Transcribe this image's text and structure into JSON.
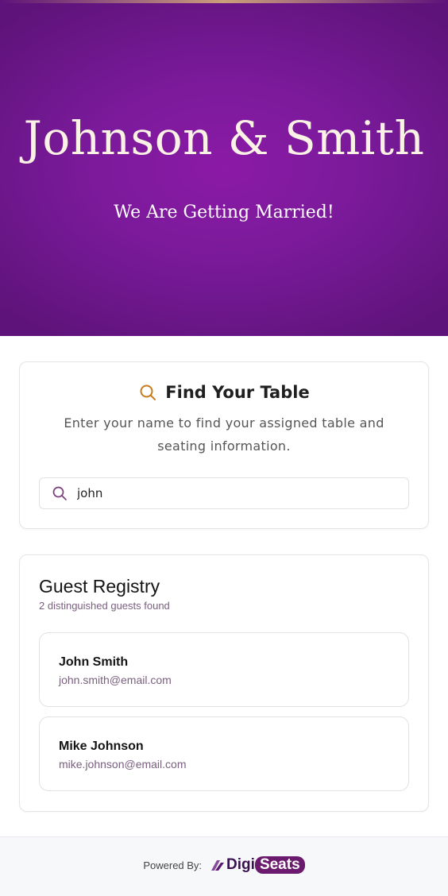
{
  "hero": {
    "title": "Johnson & Smith",
    "subtitle": "We Are Getting Married!",
    "colors": {
      "background": "#7a1a9a",
      "title_text": "#fbf2e6",
      "accent_line": "#caa07a"
    }
  },
  "find_table": {
    "icon": "search-icon",
    "title": "Find Your Table",
    "description": "Enter your name to find your assigned table and seating information.",
    "search": {
      "icon": "search-icon",
      "value": "john",
      "placeholder": ""
    }
  },
  "registry": {
    "title": "Guest Registry",
    "count_text": "2 distinguished guests found",
    "guests": [
      {
        "name": "John Smith",
        "email": "john.smith@email.com"
      },
      {
        "name": "Mike Johnson",
        "email": "mike.johnson@email.com"
      }
    ]
  },
  "footer": {
    "powered_by": "Powered By:",
    "logo": {
      "icon": "digiseats-logo-icon",
      "part1": "Digi",
      "part2": "Seats"
    }
  },
  "colors": {
    "accent_search_icon": "#c77b1a",
    "muted_text": "#7a5f7f",
    "brand_purple": "#6b1a6e"
  }
}
